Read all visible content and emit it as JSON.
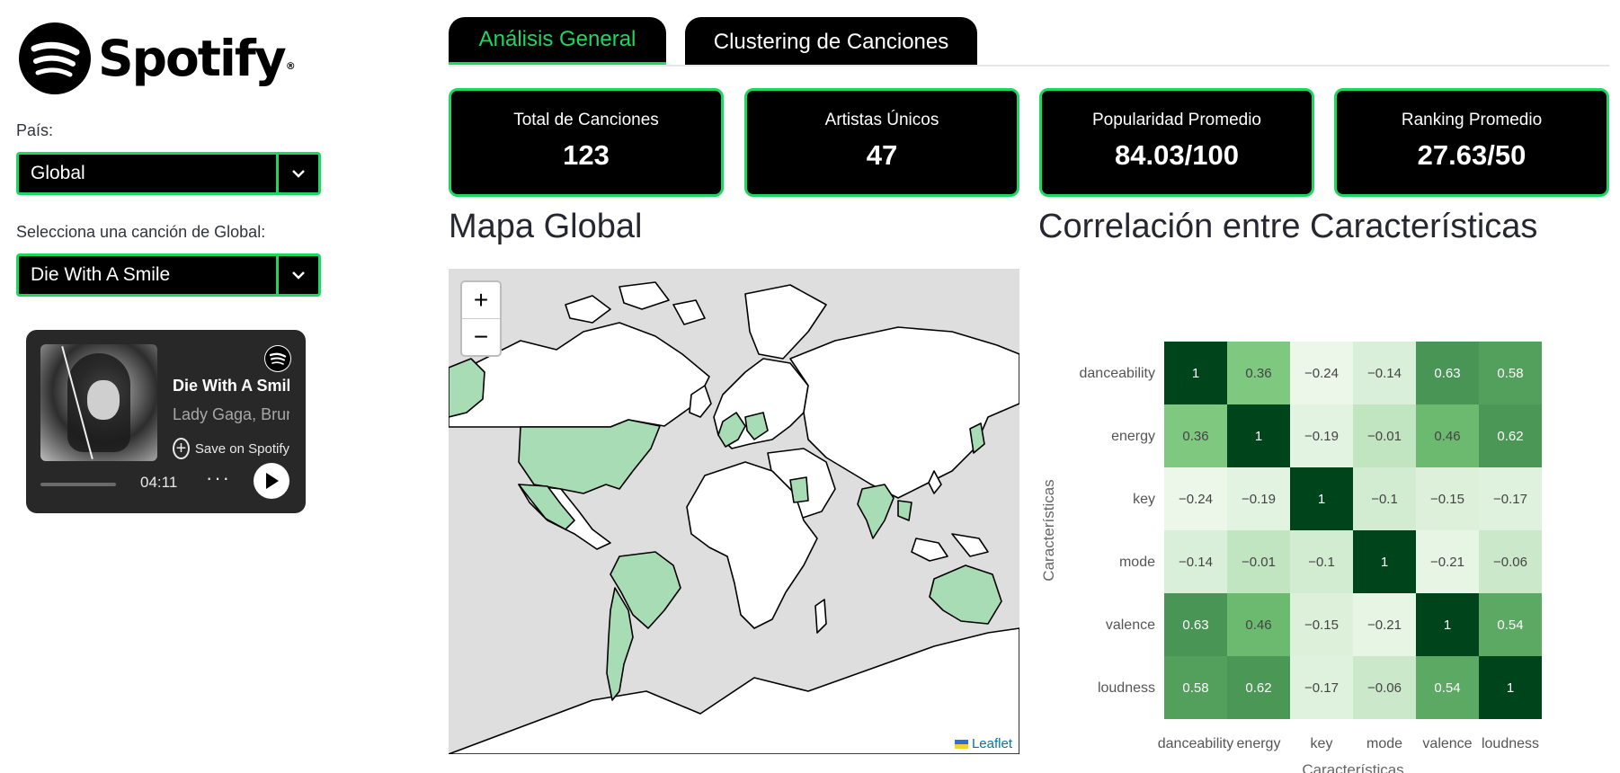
{
  "sidebar": {
    "logo_text": "Spotify",
    "country_label": "País:",
    "country_value": "Global",
    "song_label": "Selecciona una canción de Global:",
    "song_value": "Die With A Smile"
  },
  "player": {
    "title": "Die With A Smile",
    "artists": "Lady Gaga, Bruno Mars",
    "save_label": "Save on Spotify",
    "duration": "04:11",
    "progress": 0
  },
  "tabs": [
    {
      "label": "Análisis General",
      "active": true
    },
    {
      "label": "Clustering de Canciones",
      "active": false
    }
  ],
  "metrics": [
    {
      "label": "Total de Canciones",
      "value": "123"
    },
    {
      "label": "Artistas Únicos",
      "value": "47"
    },
    {
      "label": "Popularidad Promedio",
      "value": "84.03/100"
    },
    {
      "label": "Ranking Promedio",
      "value": "27.63/50"
    }
  ],
  "map": {
    "title": "Mapa Global",
    "zoom_in": "+",
    "zoom_out": "−",
    "attribution": "Leaflet"
  },
  "heatmap_title": "Correlación entre Características",
  "colors": {
    "accent": "#1ed760",
    "highlight_country": "#a8dcb5",
    "heat_low": "#f7fcf5",
    "heat_high": "#00441b"
  },
  "chart_data": {
    "type": "heatmap",
    "x": [
      "danceability",
      "energy",
      "key",
      "mode",
      "valence",
      "loudness"
    ],
    "y": [
      "danceability",
      "energy",
      "key",
      "mode",
      "valence",
      "loudness"
    ],
    "xlabel": "Características",
    "ylabel": "Características",
    "values": [
      [
        1,
        0.36,
        -0.24,
        -0.14,
        0.63,
        0.58
      ],
      [
        0.36,
        1,
        -0.19,
        -0.01,
        0.46,
        0.62
      ],
      [
        -0.24,
        -0.19,
        1,
        -0.1,
        -0.15,
        -0.17
      ],
      [
        -0.14,
        -0.01,
        -0.1,
        1,
        -0.21,
        -0.06
      ],
      [
        0.63,
        0.46,
        -0.15,
        -0.21,
        1,
        0.54
      ],
      [
        0.58,
        0.62,
        -0.17,
        -0.06,
        0.54,
        1
      ]
    ],
    "color_scale": "Greens"
  }
}
